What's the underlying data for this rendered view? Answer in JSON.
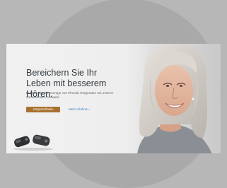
{
  "hero": {
    "headline_line1": "Bereichern Sie Ihr",
    "headline_line2": "Leben mit besserem Hören.",
    "subline": "Erleben Sie die Vorzüge von Phonak Hörgeräten mit unserer umfassenden Auswahl.",
    "cta_label": "Hörgerät finden",
    "link_label": "Mehr erfahren ›"
  },
  "colors": {
    "page_background": "#b7b7b7",
    "disc": "#a9a9a9",
    "cta": "#a9702f",
    "link": "#3f7ec0",
    "headline": "#333a40"
  },
  "icons": {
    "product": "hearing-aid-devices-icon",
    "portrait": "smiling-woman-photo"
  }
}
